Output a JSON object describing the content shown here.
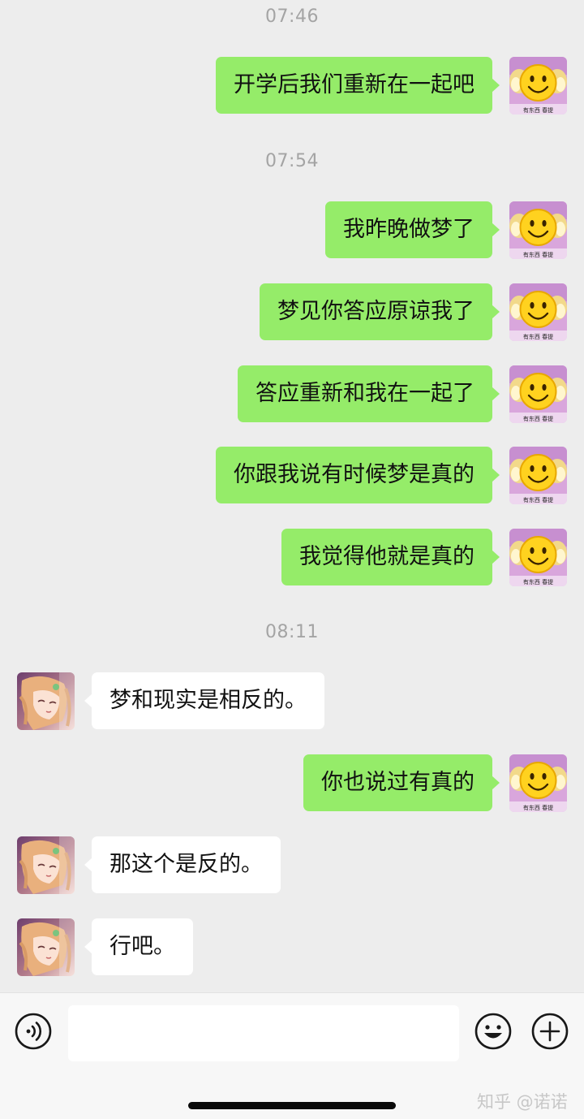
{
  "timestamps": [
    "07:46",
    "07:54",
    "08:11"
  ],
  "messages": [
    {
      "side": "right",
      "text": "开学后我们重新在一起吧"
    },
    {
      "side": "right",
      "text": "我昨晚做梦了"
    },
    {
      "side": "right",
      "text": "梦见你答应原谅我了"
    },
    {
      "side": "right",
      "text": "答应重新和我在一起了"
    },
    {
      "side": "right",
      "text": "你跟我说有时候梦是真的"
    },
    {
      "side": "right",
      "text": "我觉得他就是真的"
    },
    {
      "side": "left",
      "text": "梦和现实是相反的。"
    },
    {
      "side": "right",
      "text": "你也说过有真的"
    },
    {
      "side": "left",
      "text": "那这个是反的。"
    },
    {
      "side": "left",
      "text": "行吧。"
    }
  ],
  "my_avatar": {
    "icon": "smiley-sticker-avatar",
    "caption": "有东西 春提"
  },
  "friend_avatar": {
    "icon": "anime-girl-avatar"
  },
  "input": {
    "value": "",
    "placeholder": ""
  },
  "icons": {
    "voice": "voice-icon",
    "emoji": "emoji-icon",
    "plus": "plus-icon"
  },
  "watermark": "知乎 @诺诺",
  "colors": {
    "sent_bubble": "#95ec69",
    "received_bubble": "#ffffff",
    "background": "#ededed",
    "timestamp": "#a4a4a4"
  }
}
